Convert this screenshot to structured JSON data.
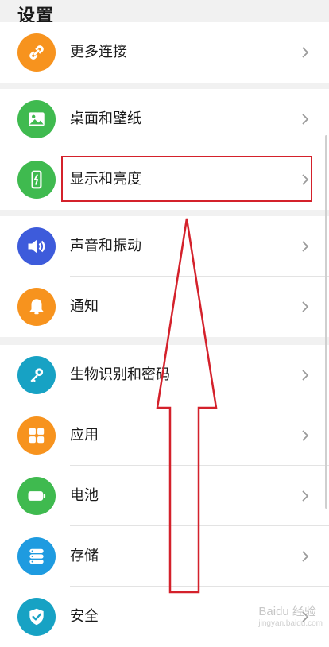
{
  "header": {
    "title": "设置"
  },
  "groups": [
    {
      "items": [
        {
          "label": "更多连接",
          "icon": "link-icon",
          "color": "#f7931e"
        }
      ]
    },
    {
      "items": [
        {
          "label": "桌面和壁纸",
          "icon": "wallpaper-icon",
          "color": "#3fba4f"
        },
        {
          "label": "显示和亮度",
          "icon": "display-brightness-icon",
          "color": "#3fba4f"
        }
      ]
    },
    {
      "items": [
        {
          "label": "声音和振动",
          "icon": "speaker-icon",
          "color": "#3d5bdb"
        },
        {
          "label": "通知",
          "icon": "bell-icon",
          "color": "#f7931e"
        }
      ]
    },
    {
      "items": [
        {
          "label": "生物识别和密码",
          "icon": "key-icon",
          "color": "#17a2c4"
        },
        {
          "label": "应用",
          "icon": "apps-grid-icon",
          "color": "#f7931e"
        },
        {
          "label": "电池",
          "icon": "battery-icon",
          "color": "#3fba4f"
        },
        {
          "label": "存储",
          "icon": "storage-icon",
          "color": "#1e9be0"
        },
        {
          "label": "安全",
          "icon": "shield-icon",
          "color": "#17a2c4"
        }
      ]
    }
  ],
  "annotation": {
    "highlighted_item": "显示和亮度",
    "highlight_color": "#d4212b"
  },
  "watermark": {
    "text": "Baidu 经验",
    "sub": "jingyan.baidu.com"
  }
}
